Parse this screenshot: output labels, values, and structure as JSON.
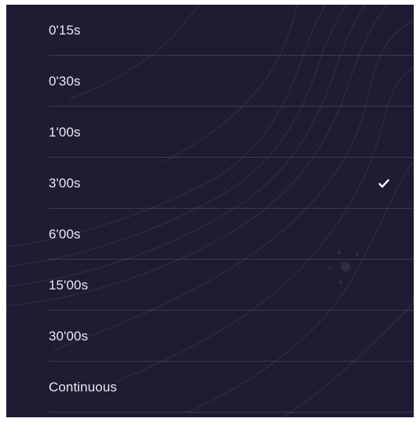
{
  "options": [
    {
      "label": "0'15s",
      "selected": false
    },
    {
      "label": "0'30s",
      "selected": false
    },
    {
      "label": "1'00s",
      "selected": false
    },
    {
      "label": "3'00s",
      "selected": true
    },
    {
      "label": "6'00s",
      "selected": false
    },
    {
      "label": "15'00s",
      "selected": false
    },
    {
      "label": "30'00s",
      "selected": false
    },
    {
      "label": "Continuous",
      "selected": false
    }
  ],
  "icons": {
    "selected": "checkmark-icon"
  },
  "colors": {
    "background": "#1e1b33",
    "text": "#e8e7ee",
    "divider": "rgba(255,255,255,0.14)",
    "check": "#ffffff"
  }
}
